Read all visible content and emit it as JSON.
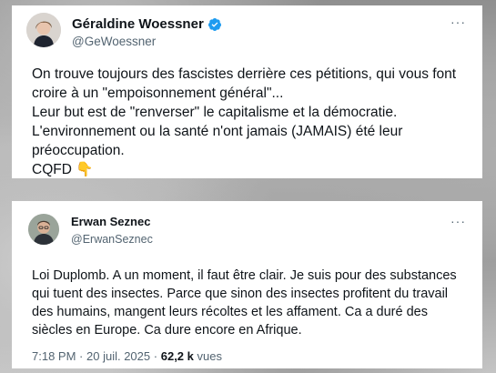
{
  "tweets": [
    {
      "author": {
        "name": "Géraldine Woessner",
        "handle": "@GeWoessner",
        "verified": true
      },
      "more_label": "···",
      "lines": [
        "On trouve toujours des fascistes derrière ces pétitions, qui vous font",
        "croire à un \"empoisonnement général\"...",
        "Leur but est de \"renverser\" le capitalisme et la démocratie.",
        "L'environnement ou la santé n'ont jamais (JAMAIS) été leur",
        "préoccupation.",
        "CQFD 👇"
      ]
    },
    {
      "author": {
        "name": "Erwan Seznec",
        "handle": "@ErwanSeznec",
        "verified": false
      },
      "more_label": "···",
      "lines": [
        "Loi Duplomb. A un moment, il faut être clair. Je suis pour des substances",
        "qui tuent des insectes. Parce que sinon des insectes profitent du travail",
        "des humains, mangent leurs récoltes et les affament. Ca a duré des",
        "siècles en Europe. Ca dure encore en Afrique."
      ],
      "meta": {
        "time": "7:18 PM",
        "separator": "·",
        "date": "20 juil. 2025",
        "views_count": "62,2 k",
        "views_label": "vues"
      }
    }
  ],
  "colors": {
    "verified": "#1d9bf0",
    "secondary_text": "#536471",
    "primary_text": "#0f1419"
  }
}
